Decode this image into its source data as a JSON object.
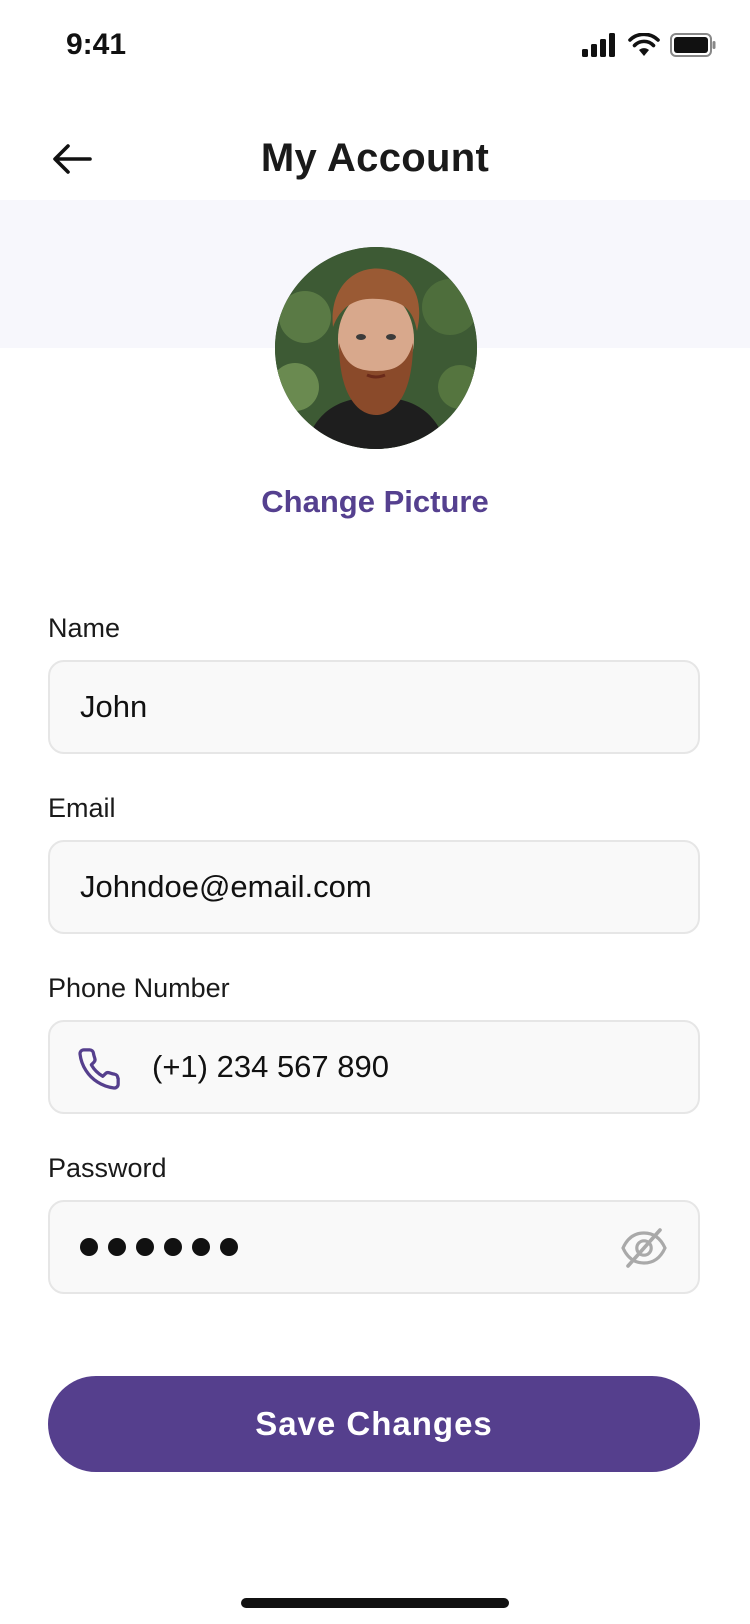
{
  "status_bar": {
    "time": "9:41"
  },
  "header": {
    "title": "My Account"
  },
  "profile": {
    "change_picture_label": "Change Picture"
  },
  "form": {
    "name": {
      "label": "Name",
      "value": "John"
    },
    "email": {
      "label": "Email",
      "value": "Johndoe@email.com"
    },
    "phone": {
      "label": "Phone Number",
      "value": "(+1) 234 567 890",
      "icon": "phone-icon"
    },
    "password": {
      "label": "Password",
      "masked_length": 6,
      "icon": "eye-off-icon"
    }
  },
  "actions": {
    "save_label": "Save Changes"
  },
  "colors": {
    "accent": "#553f8d",
    "link": "#55408f",
    "field_bg": "#f9f9f9",
    "band_bg": "#f7f7fc"
  }
}
